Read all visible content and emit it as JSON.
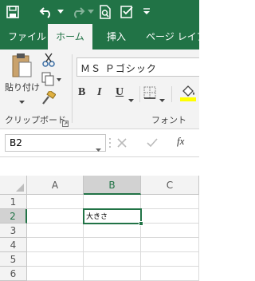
{
  "tabs": [
    "ファイル",
    "ホーム",
    "挿入",
    "ページ レイアウ"
  ],
  "active_tab": "ホーム",
  "clipboard": {
    "paste_label": "貼り付け",
    "group_label": "クリップボード"
  },
  "font": {
    "name": "ＭＳ Ｐゴシック",
    "bold": "B",
    "italic": "I",
    "underline": "U",
    "group_label": "フォント"
  },
  "formula_bar": {
    "name_box": "B2",
    "fx": "fx",
    "content": ""
  },
  "sheet": {
    "columns": [
      "A",
      "B",
      "C"
    ],
    "rows": [
      "1",
      "2",
      "3",
      "4",
      "5",
      "6"
    ],
    "selected_cell": "B2",
    "b2_value": "大きさ"
  },
  "colors": {
    "accent": "#217346",
    "ribbon_bg": "#f3f3f3"
  }
}
